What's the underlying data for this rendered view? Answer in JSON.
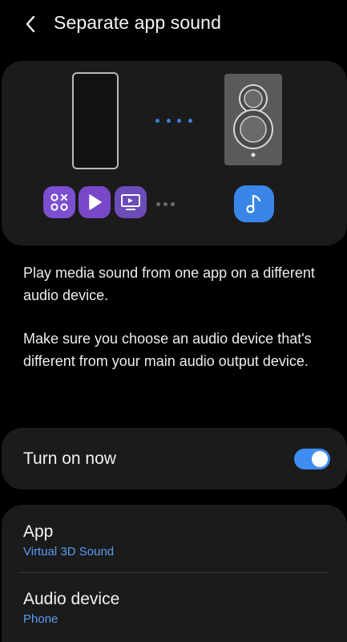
{
  "header": {
    "back_icon": "chevron-left-icon",
    "title": "Separate app sound"
  },
  "illustration": {
    "app_icons": [
      "apps-grid-icon",
      "play-icon",
      "screen-cast-icon"
    ],
    "target_icon": "music-note-icon",
    "colors": {
      "app_icon_bg": "#7b4fd0",
      "music_icon_bg": "#3a86e8",
      "connection_dots": "#3d7fe0",
      "speaker_body": "#5a5a5c"
    }
  },
  "description": {
    "paragraph1": "Play media sound from one app on a different audio device.",
    "paragraph2": "Make sure you choose an audio device that's different from your main audio output device."
  },
  "toggle": {
    "label": "Turn on now",
    "on": true,
    "accent": "#3e8df0"
  },
  "settings": {
    "app": {
      "title": "App",
      "value": "Virtual 3D Sound"
    },
    "audio_device": {
      "title": "Audio device",
      "value": "Phone"
    },
    "value_color": "#5a9cf0"
  }
}
